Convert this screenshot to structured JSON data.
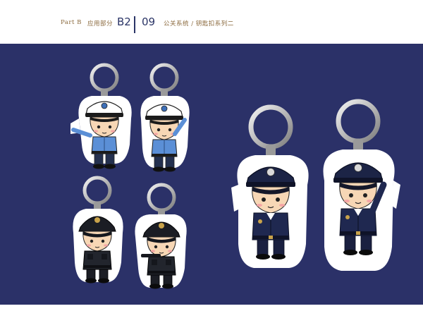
{
  "header": {
    "part_label": "Part B",
    "section_label": "应用部分",
    "section_code": "B2",
    "page_number": "09",
    "subtitle": "公关系统 / 钥匙扣系列二"
  },
  "colors": {
    "background": "#2b3168",
    "header_text": "#8b6a3e",
    "accent": "#2a3466"
  },
  "keychains": [
    {
      "name": "traffic-officer-pointing",
      "icon": "traffic-police-keychain"
    },
    {
      "name": "traffic-officer-saluting",
      "icon": "traffic-police-keychain"
    },
    {
      "name": "swat-officer-standing",
      "icon": "swat-police-keychain"
    },
    {
      "name": "swat-officer-aiming",
      "icon": "swat-police-keychain"
    },
    {
      "name": "police-officer-standing",
      "icon": "police-keychain"
    },
    {
      "name": "police-officer-saluting",
      "icon": "police-keychain"
    }
  ]
}
